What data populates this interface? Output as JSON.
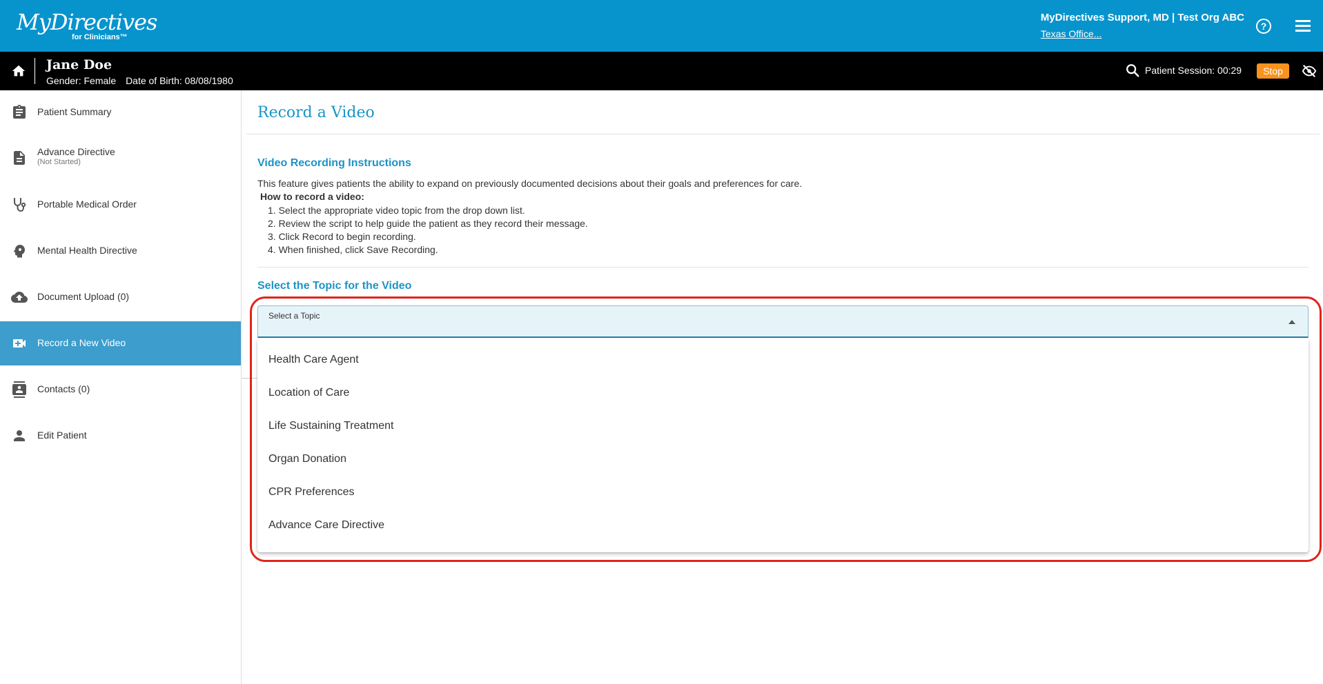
{
  "app": {
    "logo_text": "MyDirectives",
    "logo_sub": "for Clinicians™",
    "user_name": "MyDirectives Support, MD | Test Org ABC",
    "user_org": "Texas Office...",
    "help_icon": "help-circle-icon",
    "menu_icon": "hamburger-menu-icon"
  },
  "patient": {
    "name": "Jane Doe",
    "gender": "Gender: Female",
    "dob": "Date of Birth: 08/08/1980",
    "session": "Patient Session: 00:29",
    "stop_label": "Stop"
  },
  "sidebar": {
    "items": [
      {
        "label": "Patient Summary",
        "icon": "clipboard-icon"
      },
      {
        "label": "Advance Directive",
        "sub": "(Not Started)",
        "icon": "document-icon"
      },
      {
        "label": "Portable Medical Order",
        "icon": "stethoscope-icon"
      },
      {
        "label": "Mental Health Directive",
        "icon": "head-gear-icon"
      },
      {
        "label": "Document Upload (0)",
        "icon": "cloud-upload-icon"
      },
      {
        "label": "Record a New Video",
        "icon": "video-add-icon",
        "active": true
      },
      {
        "label": "Contacts (0)",
        "icon": "contacts-icon"
      },
      {
        "label": "Edit Patient",
        "icon": "person-icon"
      }
    ]
  },
  "main": {
    "title": "Record a Video",
    "instructions_title": "Video Recording Instructions",
    "intro": "This feature gives patients the ability to expand on previously documented decisions about their goals and preferences for care.",
    "how_to": "How to record a video:",
    "steps": [
      "1. Select the appropriate video topic from the drop down list.",
      "2. Review the script to help guide the patient as they record their message.",
      "3. Click Record to begin recording.",
      "4. When finished, click Save Recording."
    ],
    "topic_title": "Select the Topic for the Video",
    "select_label": "Select a Topic",
    "options": [
      "Health Care Agent",
      "Location of Care",
      "Life Sustaining Treatment",
      "Organ Donation",
      "CPR Preferences",
      "Advance Care Directive"
    ]
  },
  "colors": {
    "header_blue": "#0794cd",
    "accent_blue": "#1b94c6",
    "active_nav": "#3d9dcc",
    "stop_orange": "#f7931e",
    "highlight_red": "#e2231a"
  }
}
